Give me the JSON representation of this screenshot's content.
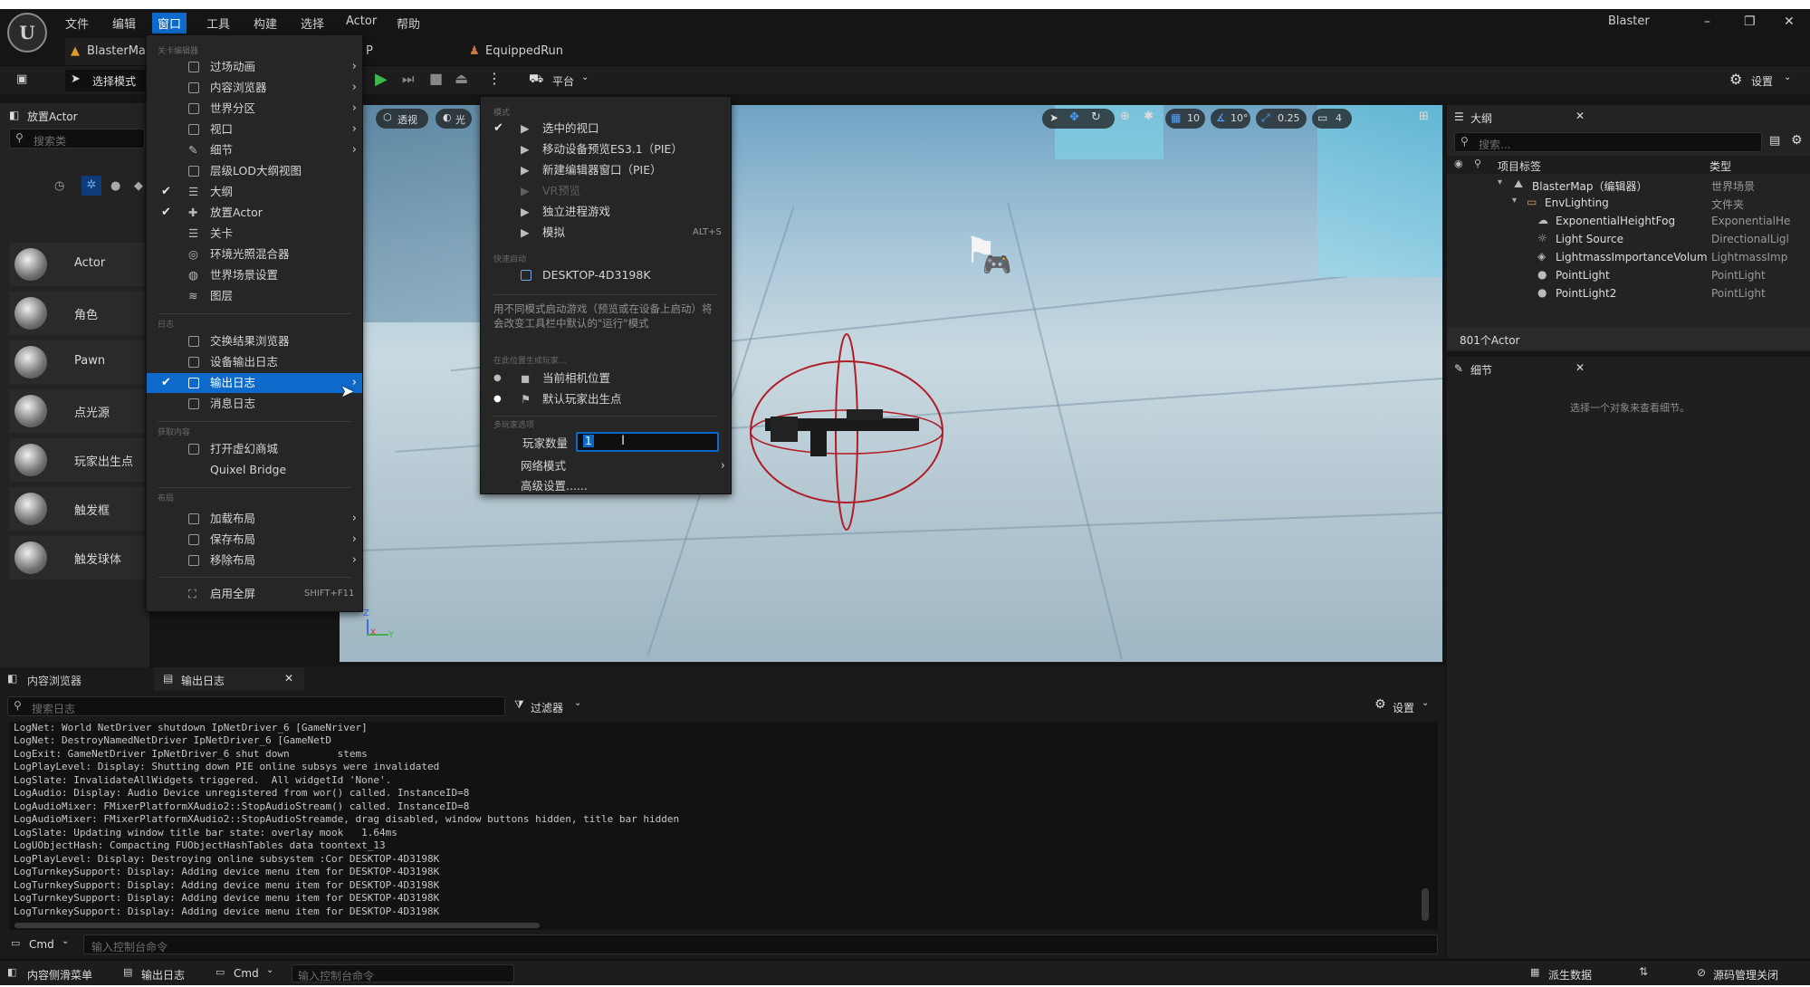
{
  "app": {
    "title": "Blaster"
  },
  "menubar": {
    "items": [
      "文件",
      "编辑",
      "窗口",
      "工具",
      "构建",
      "选择",
      "Actor",
      "帮助"
    ],
    "active_index": 2
  },
  "tabs": [
    "BlasterMa",
    "P",
    "EquippedRun"
  ],
  "toolbar": {
    "select_mode": "选择模式",
    "platform": "平台",
    "settings": "设置"
  },
  "left_panel": {
    "title": "放置Actor",
    "search_placeholder": "搜索类",
    "items": [
      "Actor",
      "角色",
      "Pawn",
      "点光源",
      "玩家出生点",
      "触发框",
      "触发球体"
    ]
  },
  "viewport": {
    "perspective": "透视",
    "lit": "光",
    "grid_snap": "10",
    "rotate_snap": "10°",
    "scale_snap": "0.25",
    "camera_speed": "4"
  },
  "window_menu": {
    "sections": {
      "level_editor": "关卡编辑器",
      "log": "日志",
      "get_content": "获取内容",
      "layout": "布局"
    },
    "items": [
      {
        "label": "过场动画",
        "submenu": true,
        "checked": false
      },
      {
        "label": "内容浏览器",
        "submenu": true,
        "checked": false
      },
      {
        "label": "世界分区",
        "submenu": true,
        "checked": false
      },
      {
        "label": "视口",
        "submenu": true,
        "checked": false
      },
      {
        "label": "细节",
        "submenu": true,
        "checked": false
      },
      {
        "label": "层级LOD大纲视图",
        "submenu": false,
        "checked": false
      },
      {
        "label": "大纲",
        "submenu": false,
        "checked": true
      },
      {
        "label": "放置Actor",
        "submenu": false,
        "checked": true
      },
      {
        "label": "关卡",
        "submenu": false,
        "checked": false
      },
      {
        "label": "环境光照混合器",
        "submenu": false,
        "checked": false
      },
      {
        "label": "世界场景设置",
        "submenu": false,
        "checked": false
      },
      {
        "label": "图层",
        "submenu": false,
        "checked": false
      }
    ],
    "log_items": [
      {
        "label": "交换结果浏览器",
        "submenu": false,
        "checked": false
      },
      {
        "label": "设备输出日志",
        "submenu": false,
        "checked": false
      },
      {
        "label": "输出日志",
        "submenu": true,
        "checked": true
      },
      {
        "label": "消息日志",
        "submenu": false,
        "checked": false
      }
    ],
    "content_items": [
      "打开虚幻商城",
      "Quixel Bridge"
    ],
    "layout_items": [
      "加载布局",
      "保存布局",
      "移除布局"
    ],
    "fullscreen": "启用全屏",
    "fullscreen_shortcut": "SHIFT+F11"
  },
  "play_menu": {
    "sections": {
      "mode": "模式",
      "quick_launch": "快速启动",
      "spawn": "在此位置生成玩家...",
      "multiplayer": "多玩家选项"
    },
    "modes": [
      {
        "label": "选中的视口",
        "checked": true,
        "disabled": false,
        "shortcut": ""
      },
      {
        "label": "移动设备预览ES3.1（PIE）",
        "checked": false,
        "disabled": false,
        "shortcut": ""
      },
      {
        "label": "新建编辑器窗口（PIE）",
        "checked": false,
        "disabled": false,
        "shortcut": ""
      },
      {
        "label": "VR预览",
        "checked": false,
        "disabled": true,
        "shortcut": ""
      },
      {
        "label": "独立进程游戏",
        "checked": false,
        "disabled": false,
        "shortcut": ""
      },
      {
        "label": "模拟",
        "checked": false,
        "disabled": false,
        "shortcut": "ALT+S"
      }
    ],
    "device": "DESKTOP-4D3198K",
    "hint": "用不同模式启动游戏（预览或在设备上启动）将会改变工具栏中默认的\"运行\"模式",
    "spawn_options": [
      "当前相机位置",
      "默认玩家出生点"
    ],
    "spawn_selected": 1,
    "players_label": "玩家数量",
    "players_value": "1",
    "net_mode": "网络模式",
    "advanced": "高级设置......"
  },
  "outliner": {
    "title": "大纲",
    "search_placeholder": "搜索...",
    "col_label": "项目标签",
    "col_type": "类型",
    "rows": [
      {
        "label": "BlasterMap（编辑器）",
        "type": "世界场景",
        "indent": 0
      },
      {
        "label": "EnvLighting",
        "type": "文件夹",
        "indent": 1
      },
      {
        "label": "ExponentialHeightFog",
        "type": "ExponentialHe",
        "indent": 2
      },
      {
        "label": "Light Source",
        "type": "DirectionalLigl",
        "indent": 2
      },
      {
        "label": "LightmassImportanceVolum",
        "type": "LightmassImp",
        "indent": 2
      },
      {
        "label": "PointLight",
        "type": "PointLight",
        "indent": 2
      },
      {
        "label": "PointLight2",
        "type": "PointLight",
        "indent": 2
      }
    ],
    "count": "801个Actor"
  },
  "details": {
    "title": "细节",
    "empty_hint": "选择一个对象来查看细节。"
  },
  "bottom": {
    "tabs": [
      "内容浏览器",
      "输出日志"
    ],
    "search_placeholder": "搜索日志",
    "filter": "过滤器",
    "settings": "设置",
    "log_lines": [
      "LogNet: World NetDriver shutdown IpNetDriver_6 [GameNriver]",
      "LogNet: DestroyNamedNetDriver IpNetDriver_6 [GameNetD",
      "LogExit: GameNetDriver IpNetDriver_6 shut down        stems",
      "LogPlayLevel: Display: Shutting down PIE online subsys were invalidated",
      "LogSlate: InvalidateAllWidgets triggered.  All widgetId 'None'.",
      "LogAudio: Display: Audio Device unregistered from wor() called. InstanceID=8",
      "LogAudioMixer: FMixerPlatformXAudio2::StopAudioStream() called. InstanceID=8",
      "LogAudioMixer: FMixerPlatformXAudio2::StopAudioStreamde, drag disabled, window buttons hidden, title bar hidden",
      "LogSlate: Updating window title bar state: overlay mook   1.64ms",
      "LogUObjectHash: Compacting FUObjectHashTables data toontext_13",
      "LogPlayLevel: Display: Destroying online subsystem :Cor DESKTOP-4D3198K",
      "LogTurnkeySupport: Display: Adding device menu item for DESKTOP-4D3198K",
      "LogTurnkeySupport: Display: Adding device menu item for DESKTOP-4D3198K",
      "LogTurnkeySupport: Display: Adding device menu item for DESKTOP-4D3198K",
      "LogTurnkeySupport: Display: Adding device menu item for DESKTOP-4D3198K"
    ],
    "cmd": "Cmd",
    "cmd_placeholder": "输入控制台命令"
  },
  "statusbar": {
    "content_drawer": "内容侧滑菜单",
    "output_log": "输出日志",
    "cmd": "Cmd",
    "cmd_placeholder": "输入控制台命令",
    "derived_data": "派生数据",
    "source_control": "源码管理关闭"
  },
  "colors": {
    "accent": "#0e6aca",
    "panel": "#232323",
    "background": "#151515"
  }
}
